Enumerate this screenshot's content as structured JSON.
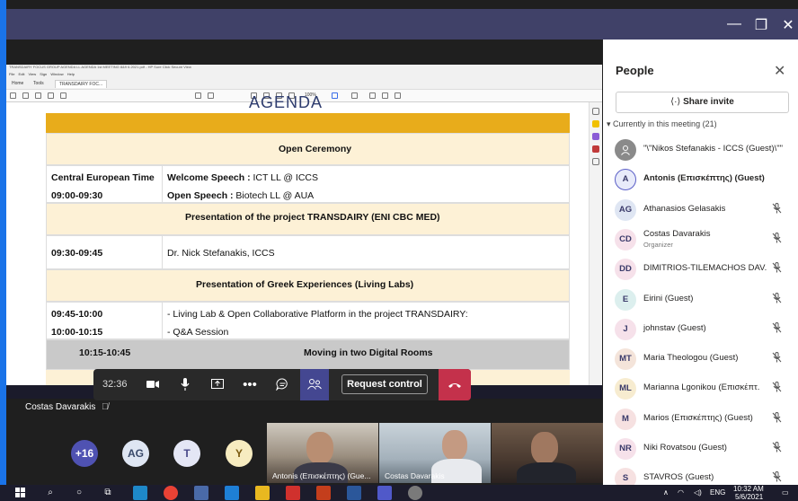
{
  "people_panel": {
    "title": "People",
    "share_label": "Share invite",
    "section_label": "Currently in this meeting (21)",
    "participants": [
      {
        "name": "\"\\\"Nikos Stefanakis - ICCS (Guest)\\\"\"",
        "initials": "",
        "role": "",
        "muted": false,
        "color": "#8a8a8a"
      },
      {
        "name": "Antonis (Επισκέπτης) (Guest)",
        "initials": "A",
        "role": "",
        "muted": false,
        "color": "#e8ebfa"
      },
      {
        "name": "Athanasios Gelasakis",
        "initials": "AG",
        "role": "",
        "muted": true,
        "color": "#dfe6f3"
      },
      {
        "name": "Costas Davarakis",
        "initials": "CD",
        "role": "Organizer",
        "muted": true,
        "color": "#f6e1ea"
      },
      {
        "name": "DIMITRIOS-TILEMACHOS DAV.",
        "initials": "DD",
        "role": "",
        "muted": true,
        "color": "#f6e1ea"
      },
      {
        "name": "Eirini (Guest)",
        "initials": "E",
        "role": "",
        "muted": true,
        "color": "#dcefee"
      },
      {
        "name": "johnstav (Guest)",
        "initials": "J",
        "role": "",
        "muted": true,
        "color": "#f6e1ea"
      },
      {
        "name": "Maria Theologou (Guest)",
        "initials": "MT",
        "role": "",
        "muted": true,
        "color": "#f4e4da"
      },
      {
        "name": "Marianna Lgonikou (Επισκέπτ.",
        "initials": "ML",
        "role": "",
        "muted": true,
        "color": "#f7ecd0"
      },
      {
        "name": "Marios (Επισκέπτης) (Guest)",
        "initials": "M",
        "role": "",
        "muted": true,
        "color": "#f6e1e1"
      },
      {
        "name": "Niki Rovatsou (Guest)",
        "initials": "NR",
        "role": "",
        "muted": true,
        "color": "#f6e1ea"
      },
      {
        "name": "STAVROS (Guest)",
        "initials": "S",
        "role": "",
        "muted": true,
        "color": "#f6e1e1"
      }
    ]
  },
  "controls": {
    "timer": "32:36",
    "request_control": "Request control"
  },
  "presenter": {
    "name": "Costas Davarakis"
  },
  "thumbnails": {
    "overflow": "+16",
    "avatars": [
      "AG",
      "T",
      "Y"
    ],
    "videos": [
      "Antonis (Επισκέπτης) (Gue...",
      "Costas Davarakis",
      ""
    ]
  },
  "pdf": {
    "title": "TRANSDAIRY FOCUS GROUP AGENDA LL AGENDA 1st MEETING 8&9 6.2021.pdf - HP Sure Click Secure View",
    "menu": "File Edit View Sign Window Help",
    "tabs": [
      "Home",
      "Tools",
      "TRANSDAIRY FOC..."
    ],
    "zoom": "100%",
    "heading": "AGENDA"
  },
  "agenda": {
    "open_ceremony": "Open Ceremony",
    "cet_label": "Central European Time",
    "slot1_time": "09:00-09:30",
    "welcome_label": "Welcome Speech :",
    "welcome_value": " ICT LL @ ICCS",
    "open_label": "Open Speech :",
    "open_value": " Biotech LL @ AUA",
    "project_heading": "Presentation of the project TRANSDAIRY (ENI CBC MED)",
    "slot2_time": "09:30-09:45",
    "slot2_speaker": "Dr. Nick Stefanakis, ICCS",
    "greek_heading": "Presentation of Greek Experiences (Living Labs)",
    "slot3_time": "09:45-10:00",
    "slot3_text": "- Living Lab & Open Collaborative Platform in the project  TRANSDAIRY:",
    "slot4_time": "10:00-10:15",
    "slot4_text": " - Q&A Session",
    "slot5_time": "10:15-10:45",
    "slot5_text": "Moving in two Digital Rooms"
  },
  "taskbar": {
    "language": "ENG",
    "time": "10:32 AM",
    "date": "5/6/2021"
  },
  "colors": {
    "teams_purple": "#444791",
    "titlebar": "#404168",
    "leave_red": "#c4314b",
    "agenda_gold": "#e8ac1b"
  }
}
